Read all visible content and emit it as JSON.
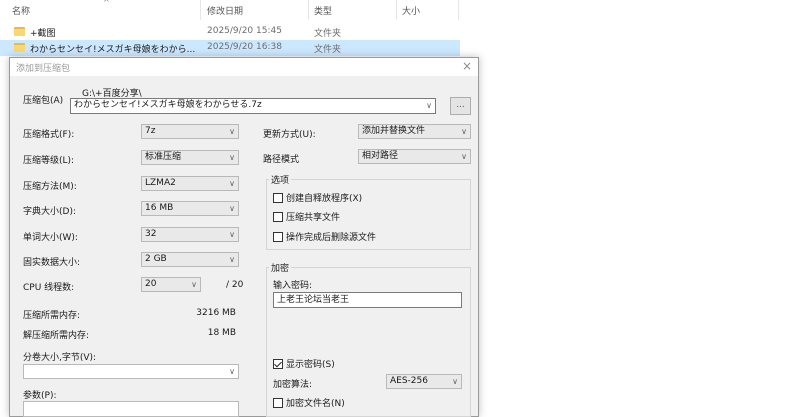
{
  "explorer": {
    "columns": {
      "name": "名称",
      "modified": "修改日期",
      "type": "类型",
      "size": "大小"
    },
    "sort_indicator": "^",
    "rows": [
      {
        "name": "+截图",
        "modified": "2025/9/20 15:45",
        "type": "文件夹"
      },
      {
        "name": "わからセンセイ!メスガキ母娘をわから...",
        "modified": "2025/9/20 16:38",
        "type": "文件夹"
      }
    ]
  },
  "dialog": {
    "title": "添加到压缩包",
    "close": "×",
    "archive": {
      "label": "压缩包(A)",
      "path": "G:\\+百度分享\\",
      "value": "わからセンセイ!メスガキ母娘をわからせる.7z",
      "browse": "..."
    },
    "left": {
      "format": {
        "label": "压缩格式(F):",
        "value": "7z"
      },
      "level": {
        "label": "压缩等级(L):",
        "value": "标准压缩"
      },
      "method": {
        "label": "压缩方法(M):",
        "value": "LZMA2"
      },
      "dict": {
        "label": "字典大小(D):",
        "value": "16 MB"
      },
      "word": {
        "label": "单词大小(W):",
        "value": "32"
      },
      "solid": {
        "label": "固实数据大小:",
        "value": "2 GB"
      },
      "threads": {
        "label": "CPU 线程数:",
        "value": "20",
        "max": "/ 20"
      },
      "mem_compress": {
        "label": "压缩所需内存:",
        "value": "3216 MB"
      },
      "mem_decompress": {
        "label": "解压缩所需内存:",
        "value": "18 MB"
      },
      "split": {
        "label": "分卷大小,字节(V):",
        "value": ""
      },
      "params": {
        "label": "参数(P):",
        "value": ""
      }
    },
    "right": {
      "update": {
        "label": "更新方式(U):",
        "value": "添加并替换文件"
      },
      "pathmode": {
        "label": "路径模式",
        "value": "相对路径"
      },
      "options": {
        "title": "选项",
        "sfx": "创建自释放程序(X)",
        "shared": "压缩共享文件",
        "delete": "操作完成后删除源文件"
      },
      "encryption": {
        "title": "加密",
        "password_label": "输入密码:",
        "password_value": "上老王论坛当老王",
        "show_password": "显示密码(S)",
        "method_label": "加密算法:",
        "method_value": "AES-256",
        "encrypt_names": "加密文件名(N)"
      }
    }
  }
}
